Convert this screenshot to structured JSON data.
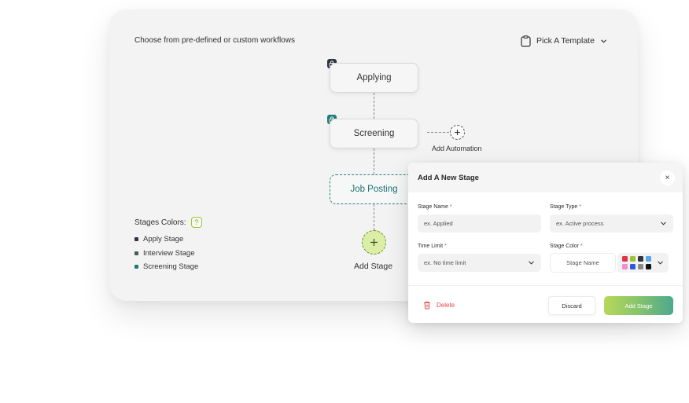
{
  "canvas": {
    "heading": "Choose from pre-defined or custom workflows",
    "template_picker": {
      "label": "Pick A Template",
      "icon": "clipboard-icon"
    }
  },
  "workflow": {
    "stages": [
      {
        "label": "Applying",
        "lock_icon": "lock-icon",
        "badge_color": "#2f3440"
      },
      {
        "label": "Screening",
        "lock_icon": "lock-icon",
        "badge_color": "#1f7b77"
      }
    ],
    "draft_stage": {
      "label": "Job Posting",
      "color": "#1f6f73"
    },
    "automation": {
      "label": "Add Automation",
      "icon": "plus-icon"
    },
    "add_stage": {
      "label": "Add Stage",
      "icon": "plus-icon",
      "color": "#dbeea5"
    }
  },
  "legend": {
    "title": "Stages Colors:",
    "help": "?",
    "items": [
      {
        "label": "Apply Stage",
        "color": "#2f3440"
      },
      {
        "label": "Interview Stage",
        "color": "#4a5a55"
      },
      {
        "label": "Screening Stage",
        "color": "#1f7b77"
      }
    ]
  },
  "modal": {
    "title": "Add A New Stage",
    "close": "×",
    "fields": {
      "stage_name": {
        "label": "Stage Name",
        "required": "*",
        "placeholder": "ex. Applied"
      },
      "stage_type": {
        "label": "Stage Type",
        "required": "*",
        "value": "ex. Active process"
      },
      "time_limit": {
        "label": "Time Limit",
        "required": "*",
        "value": "ex. No time limit"
      },
      "stage_color": {
        "label": "Stage Color",
        "required": "*",
        "placeholder": "Stage Name"
      }
    },
    "swatches": [
      "#e0344c",
      "#9cc23a",
      "#2f3440",
      "#59a6e8",
      "#f08dcb",
      "#2b59e0",
      "#8a8a8a",
      "#111111"
    ],
    "delete_label": "Delete",
    "discard_label": "Discard",
    "add_label": "Add Stage",
    "accent_color": "#e04848"
  }
}
